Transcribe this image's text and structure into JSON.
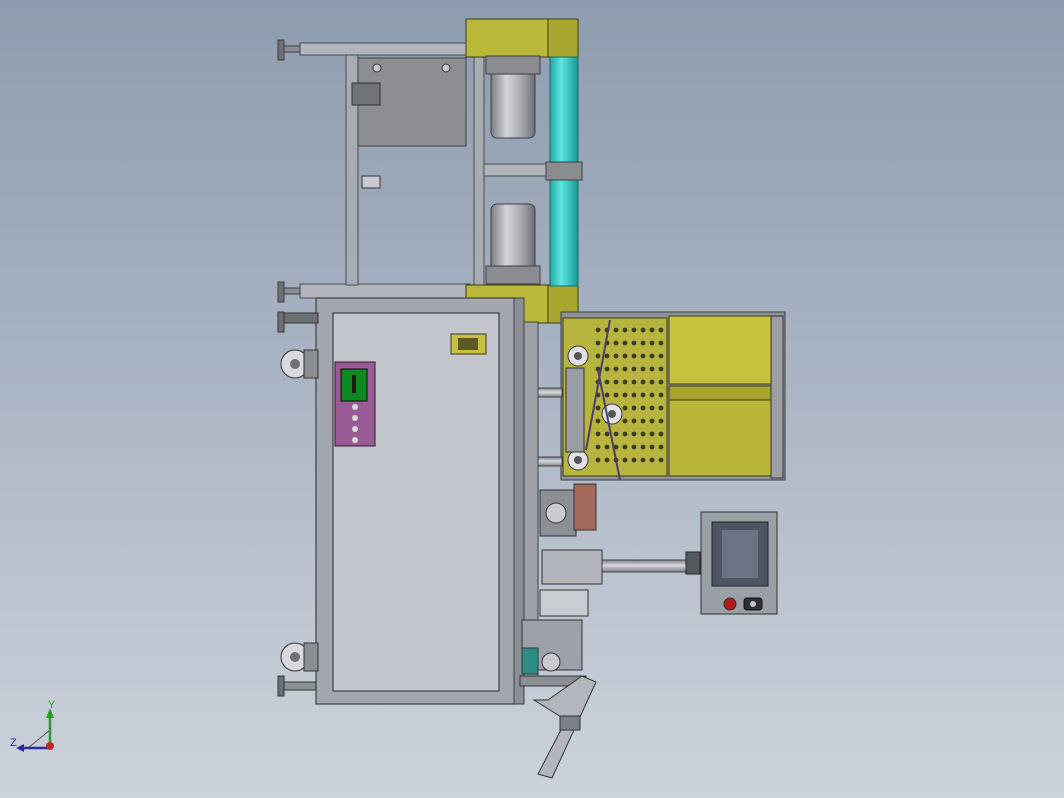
{
  "viewport": {
    "triad": {
      "x_label": "",
      "y_label": "Y",
      "z_label": "Z"
    },
    "colors": {
      "background_top": "#8e9caf",
      "background_bottom": "#cdd3dc",
      "frame_gray": "#a4a8b0",
      "panel_gray": "#8d8f93",
      "yellow": "#b9b83a",
      "cyan": "#2fc9c4",
      "purple": "#9a5a96",
      "screen_green": "#0d8a1f",
      "hmi_dark": "#4d5563"
    },
    "icons": {
      "control_box": "pink-control-box-icon",
      "estop": "emergency-stop-icon",
      "power": "power-switch-icon"
    }
  }
}
